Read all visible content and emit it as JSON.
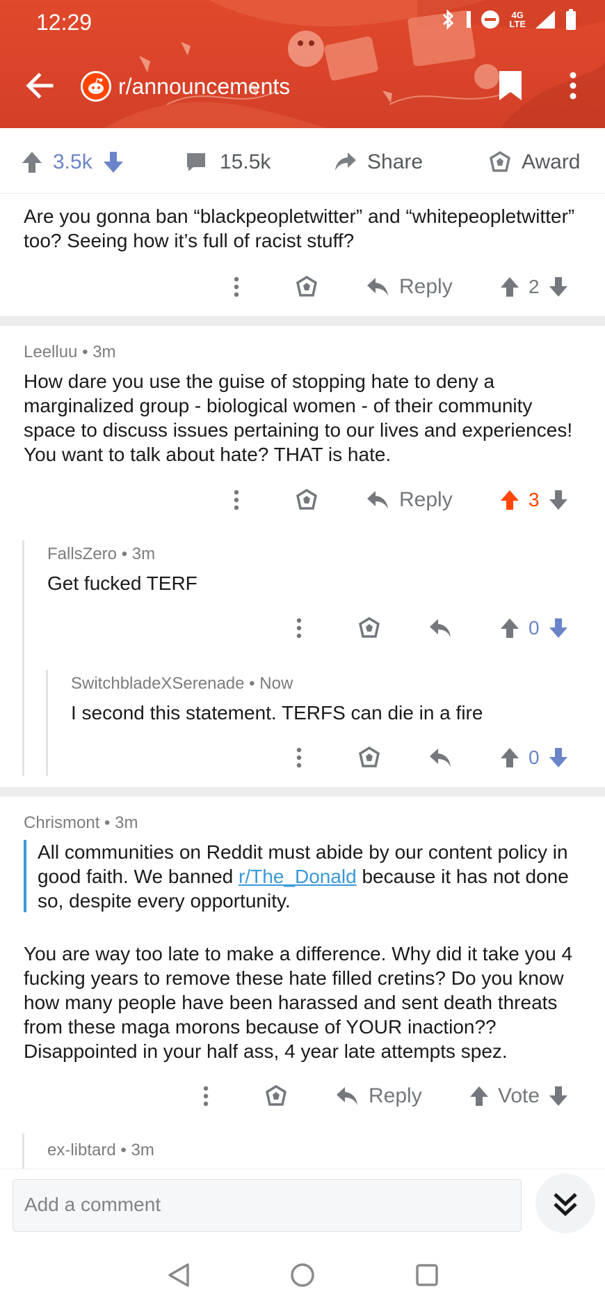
{
  "status_bar": {
    "time": "12:29",
    "network": "4G",
    "network_sub": "LTE"
  },
  "header": {
    "subreddit": "r/announcements"
  },
  "post_actions": {
    "upvotes": "3.5k",
    "comments": "15.5k",
    "share_label": "Share",
    "award_label": "Award"
  },
  "comments": [
    {
      "author": "",
      "time": "",
      "text": "Are you gonna ban “blackpeopletwitter” and “whitepeopletwitter” too? Seeing how it’s full of racist stuff?",
      "reply_label": "Reply",
      "score": "2"
    },
    {
      "author": "Leelluu",
      "time": "3m",
      "text": "How dare you use the guise of stopping hate to deny a marginalized group - biological women - of their community space to discuss issues pertaining to our lives and experiences! You want to talk about hate? THAT is hate.",
      "reply_label": "Reply",
      "score": "3"
    },
    {
      "author": "FallsZero",
      "time": "3m",
      "text": "Get fucked TERF",
      "score": "0"
    },
    {
      "author": "SwitchbladeXSerenade",
      "time": "Now",
      "text": "I second this statement. TERFS can die in a fire",
      "score": "0"
    },
    {
      "author": "Chrismont",
      "time": "3m",
      "quote_before": "All communities on Reddit must abide by our content policy in good faith. We banned ",
      "quote_link": "r/The_Donald",
      "quote_after": " because it has not done so, despite every opportunity.",
      "text": "You are way too late to make a difference. Why did it take you 4 fucking years to remove these hate filled cretins? Do you know how many people have been harassed and sent death threats from these maga morons because of YOUR inaction?? Disappointed in your half ass, 4 year late attempts spez.",
      "reply_label": "Reply",
      "vote_label": "Vote"
    },
    {
      "author": "ex-libtard",
      "time": "3m"
    }
  ],
  "composer": {
    "placeholder": "Add a comment"
  },
  "colors": {
    "header": "#d9432a",
    "upvote_active": "#ff4500",
    "downvote": "#6b84c9",
    "link": "#3a99d8"
  }
}
